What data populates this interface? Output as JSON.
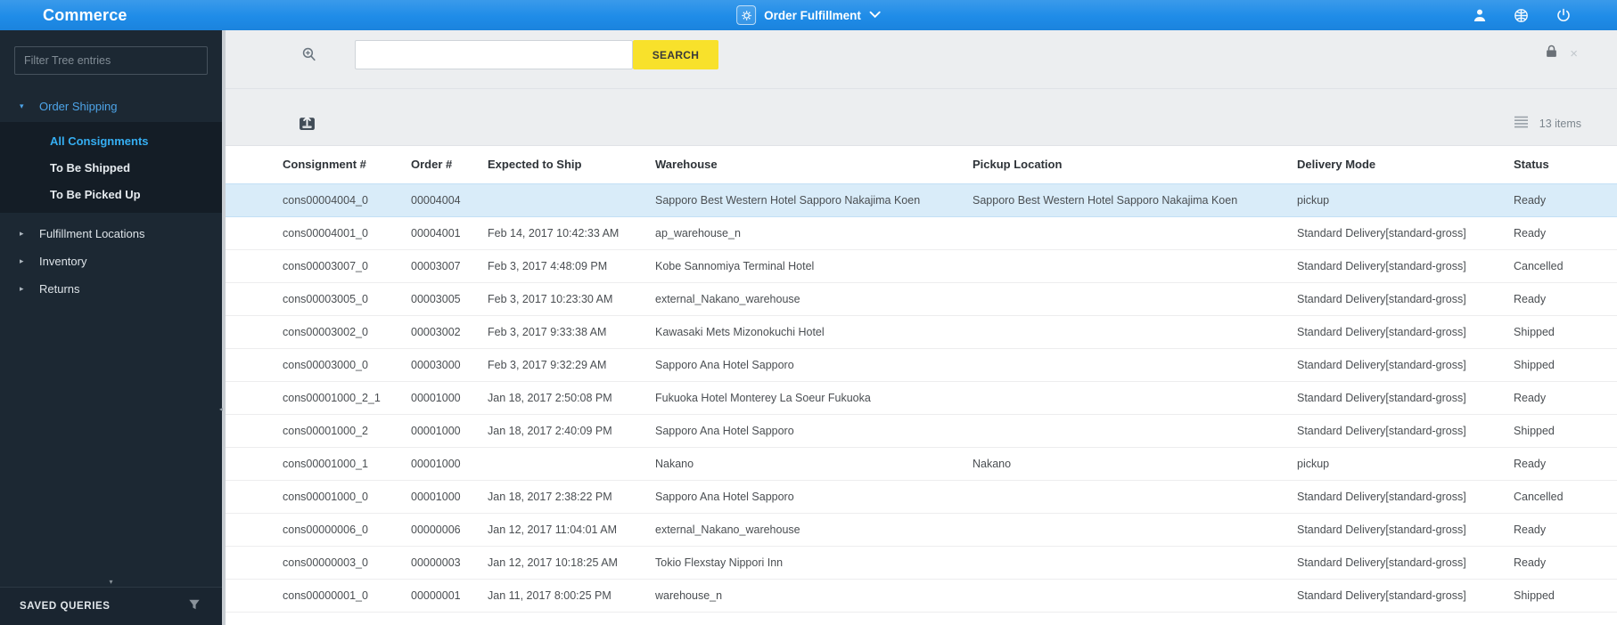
{
  "app": {
    "title": "Commerce"
  },
  "topbar": {
    "perspective_label": "Order Fulfillment",
    "icons": [
      "user-icon",
      "globe-icon",
      "power-icon"
    ]
  },
  "sidebar": {
    "filter_placeholder": "Filter Tree entries",
    "tree": [
      {
        "label": "Order Shipping",
        "expanded": true,
        "children": [
          "All Consignments",
          "To Be Shipped",
          "To Be Picked Up"
        ],
        "selected_child": "All Consignments"
      },
      {
        "label": "Fulfillment Locations",
        "expanded": false
      },
      {
        "label": "Inventory",
        "expanded": false
      },
      {
        "label": "Returns",
        "expanded": false
      }
    ],
    "saved_queries_label": "SAVED QUERIES"
  },
  "search": {
    "input_value": "",
    "button_label": "SEARCH"
  },
  "toolbar": {
    "items_count": "13 items"
  },
  "table": {
    "columns": [
      "Consignment #",
      "Order #",
      "Expected to Ship",
      "Warehouse",
      "Pickup Location",
      "Delivery Mode",
      "Status"
    ],
    "selected_row_index": 0,
    "rows": [
      [
        "cons00004004_0",
        "00004004",
        "",
        "Sapporo Best Western Hotel Sapporo Nakajima Koen",
        "Sapporo Best Western Hotel Sapporo Nakajima Koen",
        "pickup",
        "Ready"
      ],
      [
        "cons00004001_0",
        "00004001",
        "Feb 14, 2017 10:42:33 AM",
        "ap_warehouse_n",
        "",
        "Standard Delivery[standard-gross]",
        "Ready"
      ],
      [
        "cons00003007_0",
        "00003007",
        "Feb 3, 2017 4:48:09 PM",
        "Kobe Sannomiya Terminal Hotel",
        "",
        "Standard Delivery[standard-gross]",
        "Cancelled"
      ],
      [
        "cons00003005_0",
        "00003005",
        "Feb 3, 2017 10:23:30 AM",
        "external_Nakano_warehouse",
        "",
        "Standard Delivery[standard-gross]",
        "Ready"
      ],
      [
        "cons00003002_0",
        "00003002",
        "Feb 3, 2017 9:33:38 AM",
        "Kawasaki Mets Mizonokuchi Hotel",
        "",
        "Standard Delivery[standard-gross]",
        "Shipped"
      ],
      [
        "cons00003000_0",
        "00003000",
        "Feb 3, 2017 9:32:29 AM",
        "Sapporo Ana Hotel Sapporo",
        "",
        "Standard Delivery[standard-gross]",
        "Shipped"
      ],
      [
        "cons00001000_2_1",
        "00001000",
        "Jan 18, 2017 2:50:08 PM",
        "Fukuoka Hotel Monterey La Soeur Fukuoka",
        "",
        "Standard Delivery[standard-gross]",
        "Ready"
      ],
      [
        "cons00001000_2",
        "00001000",
        "Jan 18, 2017 2:40:09 PM",
        "Sapporo Ana Hotel Sapporo",
        "",
        "Standard Delivery[standard-gross]",
        "Shipped"
      ],
      [
        "cons00001000_1",
        "00001000",
        "",
        "Nakano",
        "Nakano",
        "pickup",
        "Ready"
      ],
      [
        "cons00001000_0",
        "00001000",
        "Jan 18, 2017 2:38:22 PM",
        "Sapporo Ana Hotel Sapporo",
        "",
        "Standard Delivery[standard-gross]",
        "Cancelled"
      ],
      [
        "cons00000006_0",
        "00000006",
        "Jan 12, 2017 11:04:01 AM",
        "external_Nakano_warehouse",
        "",
        "Standard Delivery[standard-gross]",
        "Ready"
      ],
      [
        "cons00000003_0",
        "00000003",
        "Jan 12, 2017 10:18:25 AM",
        "Tokio Flexstay Nippori Inn",
        "",
        "Standard Delivery[standard-gross]",
        "Ready"
      ],
      [
        "cons00000001_0",
        "00000001",
        "Jan 11, 2017 8:00:25 PM",
        "warehouse_n",
        "",
        "Standard Delivery[standard-gross]",
        "Shipped"
      ]
    ]
  },
  "colors": {
    "topbar_blue": "#1f8ce8",
    "accent_blue": "#3ea6f0",
    "sidebar_dark": "#1c2833",
    "search_button_yellow": "#f8e12b",
    "selected_row_blue": "#d9ecf9"
  }
}
